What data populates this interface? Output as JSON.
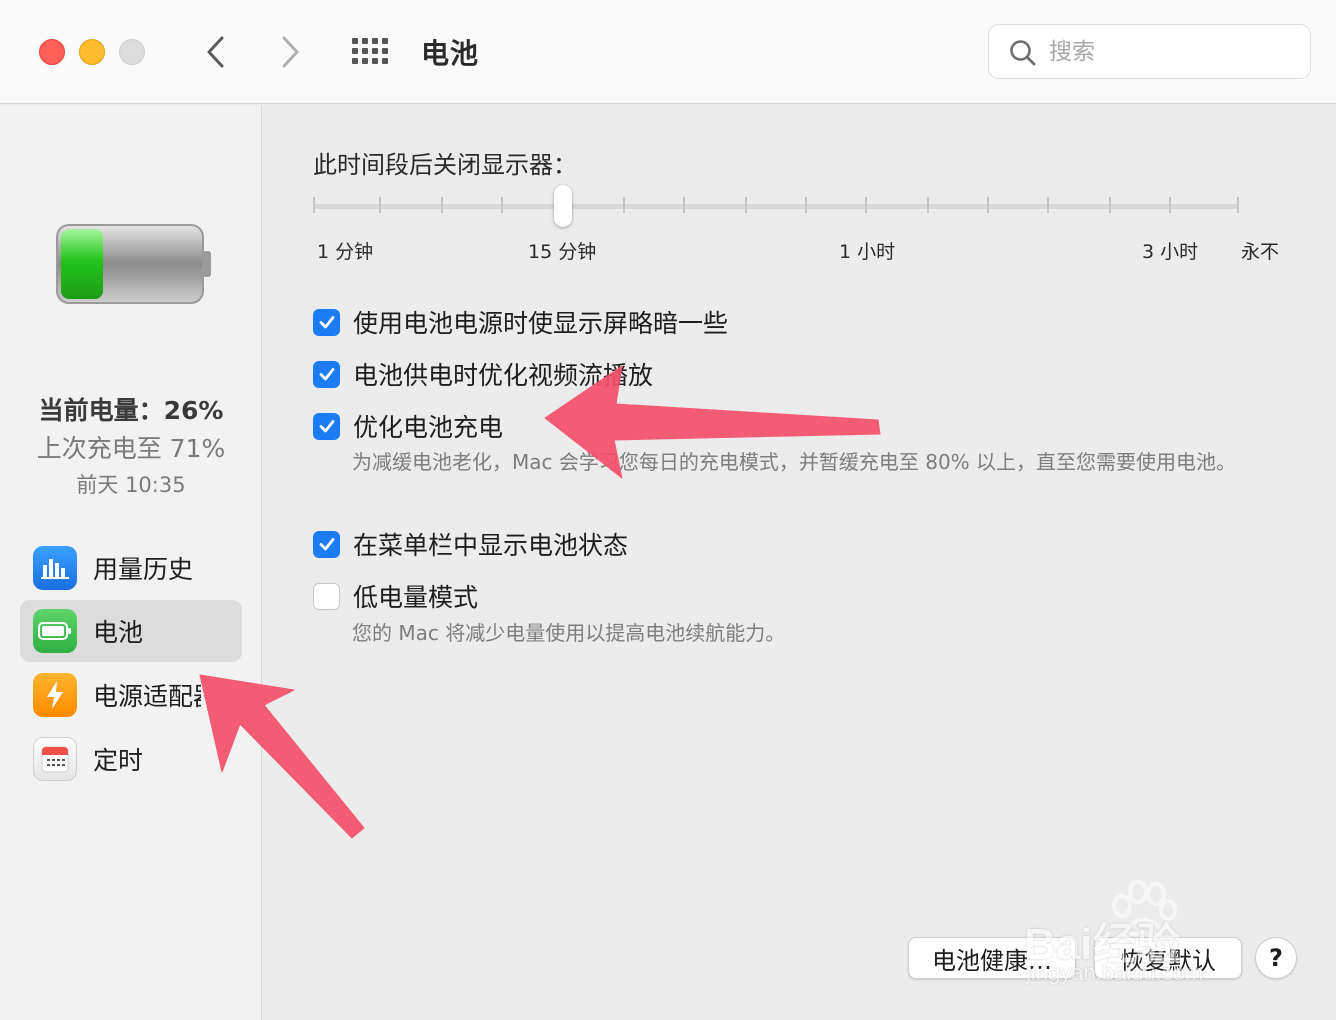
{
  "window": {
    "title": "电池",
    "search_placeholder": "搜索"
  },
  "sidebar": {
    "charge_current": "当前电量：26%",
    "last_charged": "上次充电至 71%",
    "last_charged_time": "前天 10:35",
    "items": [
      {
        "label": "用量历史",
        "icon": "bar-chart-icon"
      },
      {
        "label": "电池",
        "icon": "battery-icon",
        "selected": true
      },
      {
        "label": "电源适配器",
        "icon": "lightning-icon"
      },
      {
        "label": "定时",
        "icon": "calendar-icon"
      }
    ]
  },
  "display_sleep": {
    "title": "此时间段后关闭显示器：",
    "tick_labels": [
      "1 分钟",
      "15 分钟",
      "1 小时",
      "3 小时",
      "永不"
    ],
    "selected": "15 分钟"
  },
  "options": [
    {
      "label": "使用电池电源时使显示屏略暗一些",
      "checked": true
    },
    {
      "label": "电池供电时优化视频流播放",
      "checked": true
    },
    {
      "label": "优化电池充电",
      "checked": true,
      "description": "为减缓电池老化，Mac 会学习您每日的充电模式，并暂缓充电至 80% 以上，直至您需要使用电池。"
    },
    {
      "label": "在菜单栏中显示电池状态",
      "checked": true
    },
    {
      "label": "低电量模式",
      "checked": false,
      "description": "您的 Mac 将减少电量使用以提高电池续航能力。"
    }
  ],
  "buttons": {
    "battery_health": "电池健康…",
    "restore_defaults": "恢复默认",
    "help": "?"
  },
  "watermark": {
    "brand": "Bai经验",
    "url": "jingyan.baidu.com"
  },
  "colors": {
    "accent": "#1c7cf4",
    "annotation_arrow": "#f4506a"
  }
}
